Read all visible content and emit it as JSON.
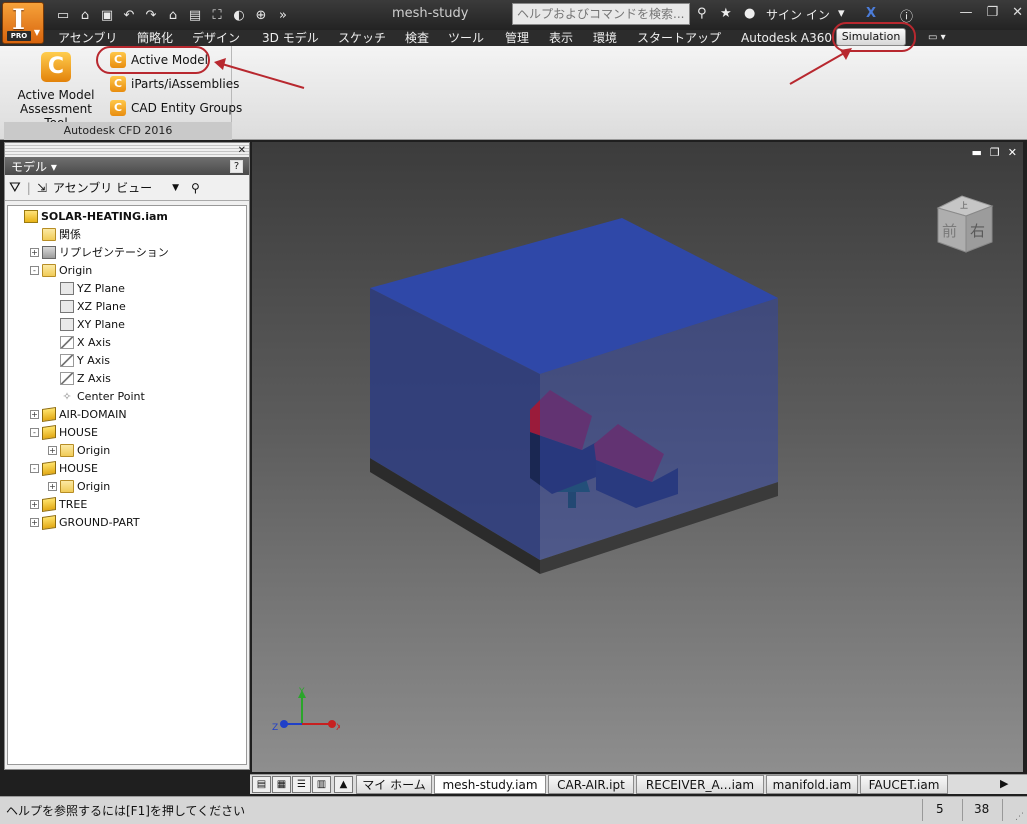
{
  "app": {
    "document_title": "mesh-study",
    "search_placeholder": "ヘルプおよびコマンドを検索...",
    "signin_label": "サイン イン",
    "pro_badge": "PRO"
  },
  "tabs": [
    {
      "label": "アセンブリ"
    },
    {
      "label": "簡略化"
    },
    {
      "label": "デザイン"
    },
    {
      "label": "3D モデル"
    },
    {
      "label": "スケッチ"
    },
    {
      "label": "検査"
    },
    {
      "label": "ツール"
    },
    {
      "label": "管理"
    },
    {
      "label": "表示"
    },
    {
      "label": "環境"
    },
    {
      "label": "スタートアップ"
    },
    {
      "label": "Autodesk A360"
    },
    {
      "label": "Simulation",
      "active": true
    }
  ],
  "ribbon": {
    "big_tool": {
      "line1": "Active Model",
      "line2": "Assessment Tool"
    },
    "small_tools": [
      {
        "label": "Active Model"
      },
      {
        "label": "iParts/iAssemblies"
      },
      {
        "label": "CAD Entity Groups"
      }
    ],
    "group_label": "Autodesk CFD 2016"
  },
  "browser": {
    "title": "モデル",
    "view_selector": "アセンブリ ビュー",
    "tree": [
      {
        "label": "SOLAR-HEATING.iam",
        "depth": 0,
        "icon": "assembly-icon",
        "expander": "",
        "bold": true
      },
      {
        "label": "関係",
        "depth": 1,
        "icon": "folder-icon",
        "expander": ""
      },
      {
        "label": "リプレゼンテーション",
        "depth": 1,
        "icon": "representation-icon",
        "expander": "+"
      },
      {
        "label": "Origin",
        "depth": 1,
        "icon": "open-folder-icon",
        "expander": "-"
      },
      {
        "label": "YZ Plane",
        "depth": 2,
        "icon": "plane-icon",
        "expander": ""
      },
      {
        "label": "XZ Plane",
        "depth": 2,
        "icon": "plane-icon",
        "expander": ""
      },
      {
        "label": "XY Plane",
        "depth": 2,
        "icon": "plane-icon",
        "expander": ""
      },
      {
        "label": "X Axis",
        "depth": 2,
        "icon": "axis-icon",
        "expander": ""
      },
      {
        "label": "Y Axis",
        "depth": 2,
        "icon": "axis-icon",
        "expander": ""
      },
      {
        "label": "Z Axis",
        "depth": 2,
        "icon": "axis-icon",
        "expander": ""
      },
      {
        "label": "Center Point",
        "depth": 2,
        "icon": "point-icon",
        "expander": ""
      },
      {
        "label": "AIR-DOMAIN",
        "depth": 1,
        "icon": "part-icon",
        "expander": "+"
      },
      {
        "label": "HOUSE",
        "depth": 1,
        "icon": "part-icon",
        "expander": "-"
      },
      {
        "label": "Origin",
        "depth": 2,
        "icon": "folder-icon",
        "expander": "+"
      },
      {
        "label": "HOUSE",
        "depth": 1,
        "icon": "part-icon",
        "expander": "-"
      },
      {
        "label": "Origin",
        "depth": 2,
        "icon": "folder-icon",
        "expander": "+"
      },
      {
        "label": "TREE",
        "depth": 1,
        "icon": "part-icon",
        "expander": "+"
      },
      {
        "label": "GROUND-PART",
        "depth": 1,
        "icon": "part-icon",
        "expander": "+"
      }
    ]
  },
  "viewcube": {
    "front_label": "前",
    "right_label": "右",
    "top_label": "上"
  },
  "triad": {
    "x": "X",
    "y": "Y",
    "z": "Z"
  },
  "document_tabs": [
    {
      "label": "マイ ホーム"
    },
    {
      "label": "mesh-study.iam",
      "active": true
    },
    {
      "label": "CAR-AIR.ipt"
    },
    {
      "label": "RECEIVER_A…iam"
    },
    {
      "label": "manifold.iam"
    },
    {
      "label": "FAUCET.iam"
    }
  ],
  "status": {
    "help_text": "ヘルプを参照するには[F1]を押してください",
    "count_a": "5",
    "count_b": "38"
  },
  "colors": {
    "callout": "#b8282f",
    "air_domain": "#33449a",
    "house_roof": "#9a1b3a",
    "tree": "#0f5a4a",
    "accent_orange": "#e8820c"
  }
}
